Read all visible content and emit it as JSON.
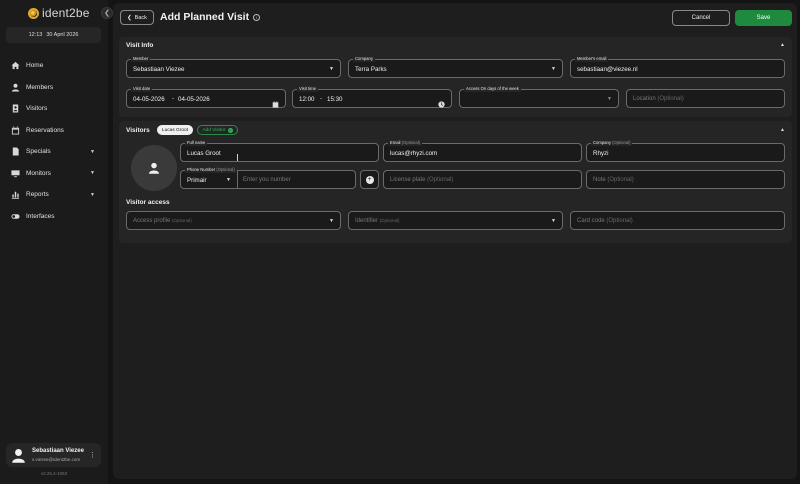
{
  "app": {
    "logo_text": "ident2be",
    "clock_time": "12:13",
    "clock_date": "30 April 2026",
    "version": "v2.25.4-1063"
  },
  "sidebar": {
    "items": [
      {
        "label": "Home",
        "icon": "home-icon",
        "has_submenu": false
      },
      {
        "label": "Members",
        "icon": "person-icon",
        "has_submenu": false
      },
      {
        "label": "Visitors",
        "icon": "badge-icon",
        "has_submenu": false
      },
      {
        "label": "Reservations",
        "icon": "calendar-icon",
        "has_submenu": false
      },
      {
        "label": "Specials",
        "icon": "document-icon",
        "has_submenu": true
      },
      {
        "label": "Monitors",
        "icon": "monitor-icon",
        "has_submenu": true
      },
      {
        "label": "Reports",
        "icon": "chart-icon",
        "has_submenu": true
      },
      {
        "label": "Interfaces",
        "icon": "toggle-icon",
        "has_submenu": false
      }
    ],
    "user": {
      "name": "Sebastiaan Viezee",
      "email": "s.viezee@ident2be.com"
    }
  },
  "header": {
    "back_label": "Back",
    "title": "Add Planned Visit",
    "cancel_label": "Cancel",
    "save_label": "Save"
  },
  "visit_info": {
    "title": "Visit Info",
    "member": {
      "label": "Member",
      "value": "Sebastiaan Viezee"
    },
    "company": {
      "label": "Company",
      "value": "Terra Parks"
    },
    "member_email": {
      "label": "Member's email",
      "value": "sebastiaan@viezee.nl"
    },
    "visit_date": {
      "label": "Visit date",
      "from": "04-05-2026",
      "to": "04-05-2026"
    },
    "visit_time": {
      "label": "Visit time",
      "from": "12:00",
      "to": "15:30"
    },
    "access_days": {
      "label": "Access On days of the week",
      "value": ""
    },
    "location": {
      "placeholder": "Location",
      "optional": "(Optional)"
    }
  },
  "visitors": {
    "title": "Visitors",
    "chip_name": "Lucas Groot",
    "add_visitor_label": "Add Visitor",
    "full_name": {
      "label": "Full name",
      "value": "Lucas Groot"
    },
    "email": {
      "label": "Email",
      "optional": "(Optional)",
      "value": "lucas@rhyzi.com"
    },
    "company": {
      "label": "Company",
      "optional": "(Optional)",
      "value": "Rhyzi"
    },
    "phone": {
      "label": "Phone Number",
      "optional": "(Optional)",
      "prefix": "Primair",
      "placeholder": "Enter you number"
    },
    "license_plate": {
      "placeholder": "License plate",
      "optional": "(Optional)"
    },
    "note": {
      "placeholder": "Note",
      "optional": "(Optional)"
    },
    "access_title": "Visitor access",
    "access_profile": {
      "placeholder": "Access profile",
      "optional": "(Optional)"
    },
    "identifier": {
      "placeholder": "Identifier",
      "optional": "(Optional)"
    },
    "card_code": {
      "placeholder": "Card code",
      "optional": "(Optional)"
    }
  }
}
